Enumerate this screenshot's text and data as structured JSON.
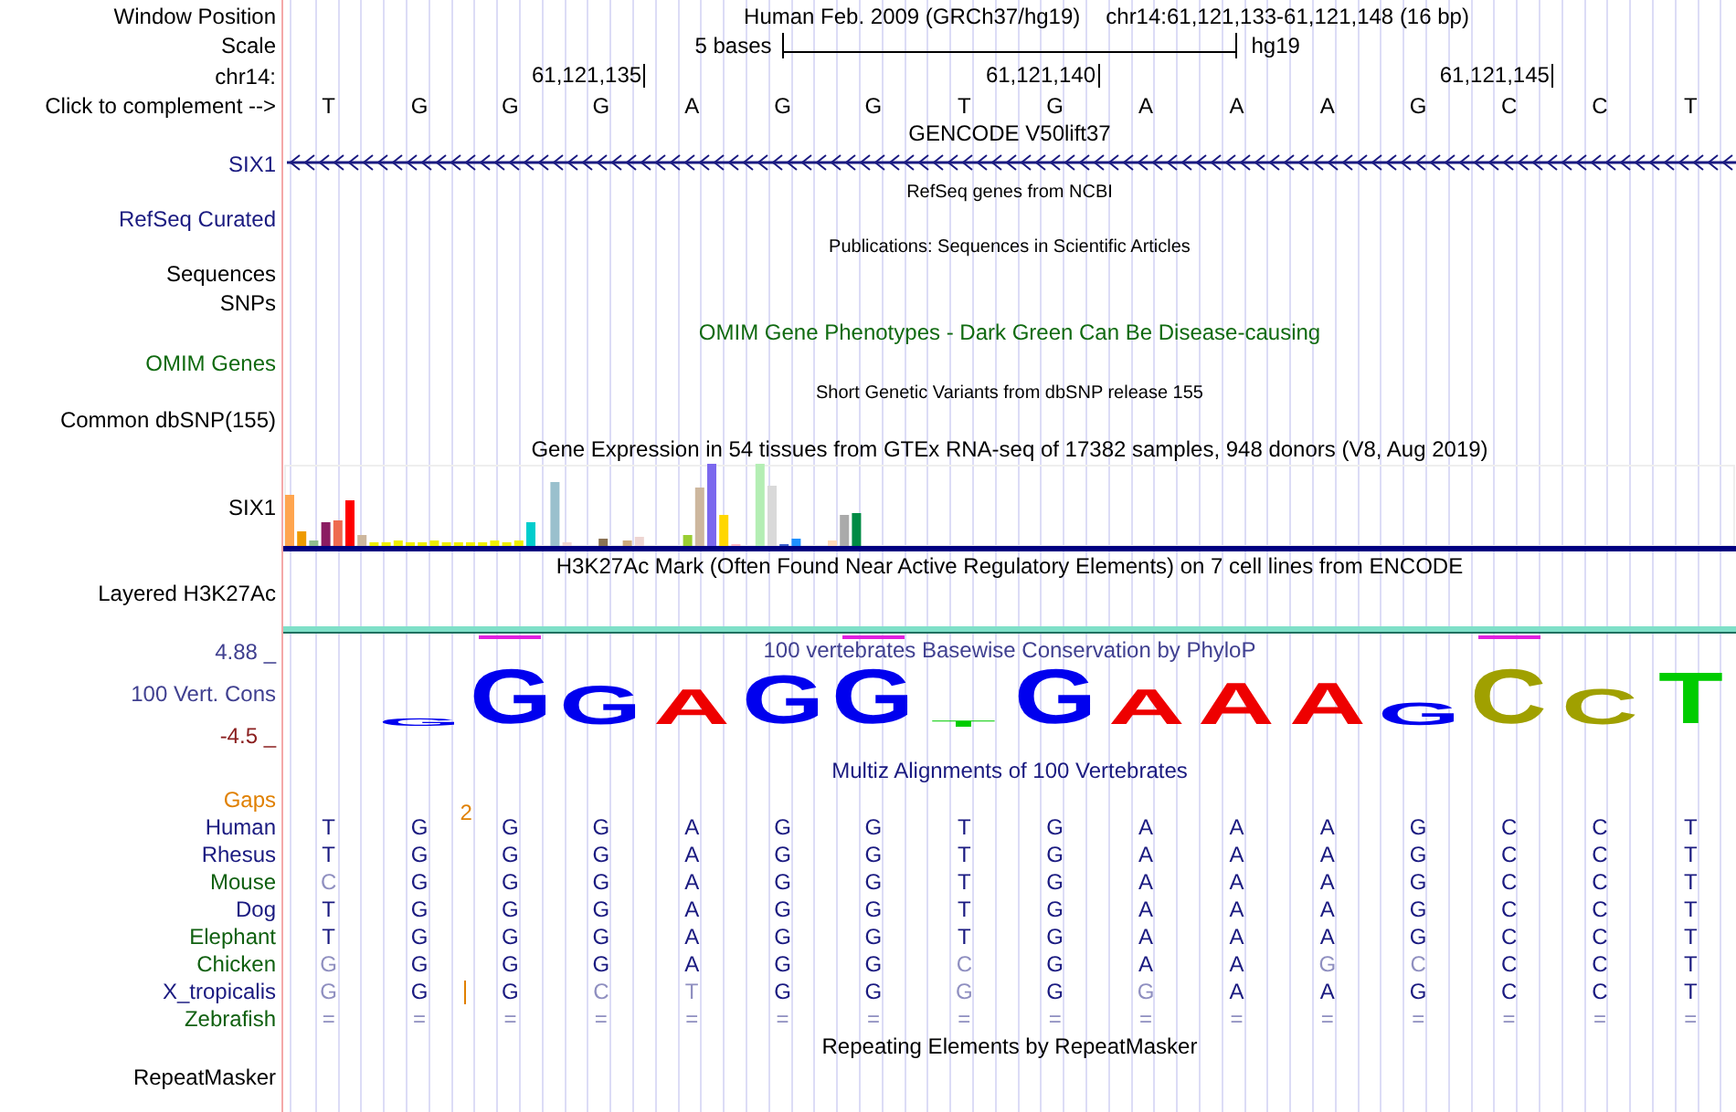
{
  "header": {
    "window_position_label": "Window Position",
    "assembly": "Human Feb. 2009 (GRCh37/hg19)",
    "position": "chr14:61,121,133-61,121,148 (16 bp)",
    "scale_label": "Scale",
    "scale_text": "5 bases",
    "scale_db": "hg19",
    "chrom_label": "chr14:",
    "ticks": [
      "61,121,135",
      "61,121,140",
      "61,121,145"
    ],
    "complement_label": "Click to complement -->"
  },
  "bases": [
    "T",
    "G",
    "G",
    "G",
    "A",
    "G",
    "G",
    "T",
    "G",
    "A",
    "A",
    "A",
    "G",
    "C",
    "C",
    "T"
  ],
  "tracks": [
    {
      "kind": "gene",
      "title": "GENCODE V50lift37",
      "label": "SIX1"
    },
    {
      "kind": "empty",
      "title": "RefSeq genes from NCBI",
      "label": "RefSeq Curated",
      "small": true
    },
    {
      "kind": "empty",
      "title": "Publications: Sequences in Scientific Articles",
      "label": "Sequences",
      "small": true
    },
    {
      "kind": "plain",
      "label": "SNPs"
    },
    {
      "kind": "empty",
      "title": "OMIM Gene Phenotypes - Dark Green Can Be Disease-causing",
      "label": "OMIM Genes",
      "green": true
    },
    {
      "kind": "empty",
      "title": "Short Genetic Variants from dbSNP release 155",
      "label": "Common dbSNP(155)",
      "small": true
    },
    {
      "kind": "expression",
      "title": "Gene Expression in 54 tissues from GTEx RNA-seq of 17382 samples, 948 donors (V8, Aug 2019)",
      "label": "SIX1"
    },
    {
      "kind": "signal",
      "title": "H3K27Ac Mark (Often Found Near Active Regulatory Elements) on 7 cell lines from ENCODE",
      "label": "Layered H3K27Ac"
    },
    {
      "kind": "logo",
      "title": "100 vertebrates Basewise Conservation by PhyloP",
      "label": "100 Vert. Cons",
      "max": "4.88 _",
      "min": "-4.5 _",
      "letters": [
        {
          "base": "G",
          "color": "#0000ee",
          "marked": false
        },
        {
          "base": "G",
          "color": "#0000ee",
          "marked": true
        },
        {
          "base": "G",
          "color": "#0000ee",
          "marked": false
        },
        {
          "base": "A",
          "color": "#ee0000",
          "marked": false
        },
        {
          "base": "G",
          "color": "#0000ee",
          "marked": false
        },
        {
          "base": "G",
          "color": "#0000ee",
          "marked": true
        },
        {
          "base": "T",
          "color": "#00cc00",
          "marked": false
        },
        {
          "base": "G",
          "color": "#0000ee",
          "marked": false
        },
        {
          "base": "A",
          "color": "#ee0000",
          "marked": false
        },
        {
          "base": "A",
          "color": "#ee0000",
          "marked": false
        },
        {
          "base": "A",
          "color": "#ee0000",
          "marked": false
        },
        {
          "base": "G",
          "color": "#0000ee",
          "marked": false
        },
        {
          "base": "C",
          "color": "#a0a000",
          "marked": true
        },
        {
          "base": "C",
          "color": "#a0a000",
          "marked": false
        },
        {
          "base": "T",
          "color": "#00cc00",
          "marked": false
        }
      ]
    },
    {
      "kind": "alignment",
      "title": "Multiz Alignments of 100 Vertebrates",
      "gaps": {
        "label": "Gaps",
        "count": "2"
      },
      "species": [
        {
          "name": "Human",
          "color": "#1a1a80",
          "bases": [
            {
              "b": "T",
              "diff": false
            },
            {
              "b": "G",
              "diff": false
            },
            {
              "b": "G",
              "diff": false
            },
            {
              "b": "G",
              "diff": false
            },
            {
              "b": "A",
              "diff": false
            },
            {
              "b": "G",
              "diff": false
            },
            {
              "b": "G",
              "diff": false
            },
            {
              "b": "T",
              "diff": false
            },
            {
              "b": "G",
              "diff": false
            },
            {
              "b": "A",
              "diff": false
            },
            {
              "b": "A",
              "diff": false
            },
            {
              "b": "A",
              "diff": false
            },
            {
              "b": "G",
              "diff": false
            },
            {
              "b": "C",
              "diff": false
            },
            {
              "b": "C",
              "diff": false
            },
            {
              "b": "T",
              "diff": false
            }
          ]
        },
        {
          "name": "Rhesus",
          "color": "#1a1a80",
          "bases": [
            {
              "b": "T",
              "diff": false
            },
            {
              "b": "G",
              "diff": false
            },
            {
              "b": "G",
              "diff": false
            },
            {
              "b": "G",
              "diff": false
            },
            {
              "b": "A",
              "diff": false
            },
            {
              "b": "G",
              "diff": false
            },
            {
              "b": "G",
              "diff": false
            },
            {
              "b": "T",
              "diff": false
            },
            {
              "b": "G",
              "diff": false
            },
            {
              "b": "A",
              "diff": false
            },
            {
              "b": "A",
              "diff": false
            },
            {
              "b": "A",
              "diff": false
            },
            {
              "b": "G",
              "diff": false
            },
            {
              "b": "C",
              "diff": false
            },
            {
              "b": "C",
              "diff": false
            },
            {
              "b": "T",
              "diff": false
            }
          ]
        },
        {
          "name": "Mouse",
          "color": "#106010",
          "bases": [
            {
              "b": "C",
              "diff": true
            },
            {
              "b": "G",
              "diff": false
            },
            {
              "b": "G",
              "diff": false
            },
            {
              "b": "G",
              "diff": false
            },
            {
              "b": "A",
              "diff": false
            },
            {
              "b": "G",
              "diff": false
            },
            {
              "b": "G",
              "diff": false
            },
            {
              "b": "T",
              "diff": false
            },
            {
              "b": "G",
              "diff": false
            },
            {
              "b": "A",
              "diff": false
            },
            {
              "b": "A",
              "diff": false
            },
            {
              "b": "A",
              "diff": false
            },
            {
              "b": "G",
              "diff": false
            },
            {
              "b": "C",
              "diff": false
            },
            {
              "b": "C",
              "diff": false
            },
            {
              "b": "T",
              "diff": false
            }
          ]
        },
        {
          "name": "Dog",
          "color": "#1a1a80",
          "bases": [
            {
              "b": "T",
              "diff": false
            },
            {
              "b": "G",
              "diff": false
            },
            {
              "b": "G",
              "diff": false
            },
            {
              "b": "G",
              "diff": false
            },
            {
              "b": "A",
              "diff": false
            },
            {
              "b": "G",
              "diff": false
            },
            {
              "b": "G",
              "diff": false
            },
            {
              "b": "T",
              "diff": false
            },
            {
              "b": "G",
              "diff": false
            },
            {
              "b": "A",
              "diff": false
            },
            {
              "b": "A",
              "diff": false
            },
            {
              "b": "A",
              "diff": false
            },
            {
              "b": "G",
              "diff": false
            },
            {
              "b": "C",
              "diff": false
            },
            {
              "b": "C",
              "diff": false
            },
            {
              "b": "T",
              "diff": false
            }
          ]
        },
        {
          "name": "Elephant",
          "color": "#106010",
          "bases": [
            {
              "b": "T",
              "diff": false
            },
            {
              "b": "G",
              "diff": false
            },
            {
              "b": "G",
              "diff": false
            },
            {
              "b": "G",
              "diff": false
            },
            {
              "b": "A",
              "diff": false
            },
            {
              "b": "G",
              "diff": false
            },
            {
              "b": "G",
              "diff": false
            },
            {
              "b": "T",
              "diff": false
            },
            {
              "b": "G",
              "diff": false
            },
            {
              "b": "A",
              "diff": false
            },
            {
              "b": "A",
              "diff": false
            },
            {
              "b": "A",
              "diff": false
            },
            {
              "b": "G",
              "diff": false
            },
            {
              "b": "C",
              "diff": false
            },
            {
              "b": "C",
              "diff": false
            },
            {
              "b": "T",
              "diff": false
            }
          ]
        },
        {
          "name": "Chicken",
          "color": "#106010",
          "bases": [
            {
              "b": "G",
              "diff": true
            },
            {
              "b": "G",
              "diff": false
            },
            {
              "b": "G",
              "diff": false
            },
            {
              "b": "G",
              "diff": false
            },
            {
              "b": "A",
              "diff": false
            },
            {
              "b": "G",
              "diff": false
            },
            {
              "b": "G",
              "diff": false
            },
            {
              "b": "C",
              "diff": true
            },
            {
              "b": "G",
              "diff": false
            },
            {
              "b": "A",
              "diff": false
            },
            {
              "b": "A",
              "diff": false
            },
            {
              "b": "G",
              "diff": true
            },
            {
              "b": "C",
              "diff": true
            },
            {
              "b": "C",
              "diff": false
            },
            {
              "b": "C",
              "diff": false
            },
            {
              "b": "T",
              "diff": false
            }
          ]
        },
        {
          "name": "X_tropicalis",
          "color": "#1a1a80",
          "bases": [
            {
              "b": "G",
              "diff": true
            },
            {
              "b": "G",
              "diff": false,
              "insertion": true
            },
            {
              "b": "G",
              "diff": false
            },
            {
              "b": "C",
              "diff": true
            },
            {
              "b": "T",
              "diff": true
            },
            {
              "b": "G",
              "diff": false
            },
            {
              "b": "G",
              "diff": false
            },
            {
              "b": "G",
              "diff": true
            },
            {
              "b": "G",
              "diff": false
            },
            {
              "b": "G",
              "diff": true
            },
            {
              "b": "A",
              "diff": false
            },
            {
              "b": "A",
              "diff": false
            },
            {
              "b": "G",
              "diff": false
            },
            {
              "b": "C",
              "diff": false
            },
            {
              "b": "C",
              "diff": false
            },
            {
              "b": "T",
              "diff": false
            }
          ]
        },
        {
          "name": "Zebrafish",
          "color": "#106010",
          "bases": [
            {
              "b": "=",
              "diff": true
            },
            {
              "b": "=",
              "diff": true
            },
            {
              "b": "=",
              "diff": true
            },
            {
              "b": "=",
              "diff": true
            },
            {
              "b": "=",
              "diff": true
            },
            {
              "b": "=",
              "diff": true
            },
            {
              "b": "=",
              "diff": true
            },
            {
              "b": "=",
              "diff": true
            },
            {
              "b": "=",
              "diff": true
            },
            {
              "b": "=",
              "diff": true
            },
            {
              "b": "=",
              "diff": true
            },
            {
              "b": "=",
              "diff": true
            },
            {
              "b": "=",
              "diff": true
            },
            {
              "b": "=",
              "diff": true
            },
            {
              "b": "=",
              "diff": true
            },
            {
              "b": "=",
              "diff": true
            }
          ]
        }
      ]
    },
    {
      "kind": "empty",
      "title": "Repeating Elements by RepeatMasker",
      "label": "RepeatMasker"
    }
  ]
}
